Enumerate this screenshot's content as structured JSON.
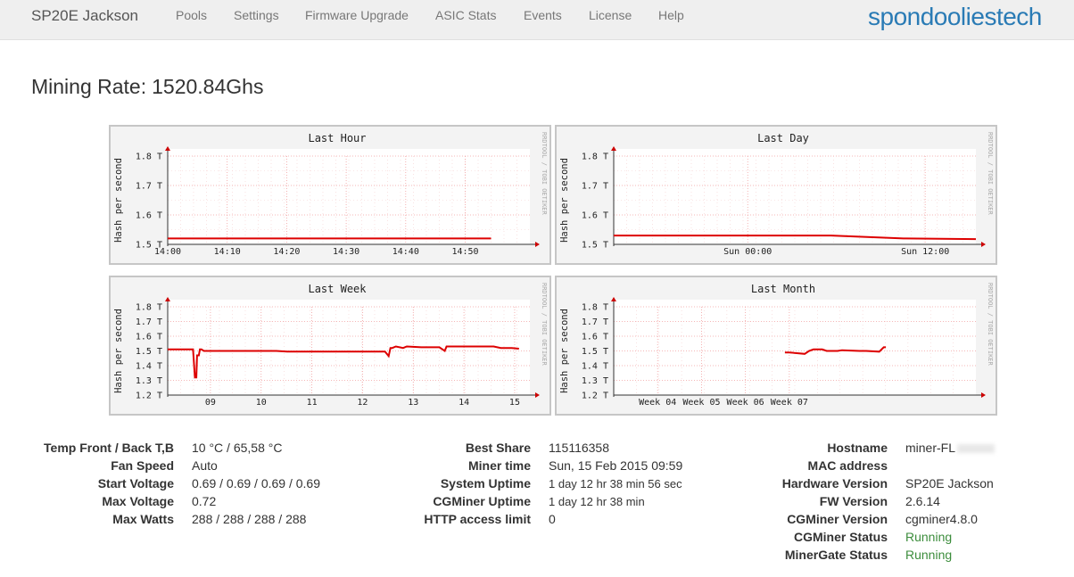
{
  "nav": {
    "brand": "SP20E Jackson",
    "items": [
      "Pools",
      "Settings",
      "Firmware Upgrade",
      "ASIC Stats",
      "Events",
      "License",
      "Help"
    ],
    "logo": "spondooliestech"
  },
  "mining_rate": {
    "label": "Mining Rate:",
    "value": "1520.84Ghs"
  },
  "colors": {
    "line": "#dd0000",
    "accent": "#2a7bb5",
    "running": "#3c8d3c"
  },
  "chart_data": [
    {
      "type": "line",
      "title": "Last Hour",
      "ylabel": "Hash per second",
      "ylim": [
        1.5,
        1.8
      ],
      "yticks": [
        "1.8 T",
        "1.7 T",
        "1.6 T",
        "1.5 T"
      ],
      "xticks": [
        "14:00",
        "14:10",
        "14:20",
        "14:30",
        "14:40",
        "14:50"
      ],
      "watermark": "RRDTOOL / TOBI OETIKER",
      "series": [
        {
          "x": [
            0,
            62.5
          ],
          "y": [
            1.52,
            1.52
          ]
        }
      ]
    },
    {
      "type": "line",
      "title": "Last Day",
      "ylabel": "Hash per second",
      "ylim": [
        1.5,
        1.8
      ],
      "yticks": [
        "1.8 T",
        "1.7 T",
        "1.6 T",
        "1.5 T"
      ],
      "xticks": [
        "Sun 00:00",
        "Sun 12:00"
      ],
      "watermark": "RRDTOOL / TOBI OETIKER",
      "series": [
        {
          "x": [
            0,
            60,
            70,
            80,
            100
          ],
          "y": [
            1.53,
            1.53,
            1.525,
            1.52,
            1.518
          ]
        }
      ]
    },
    {
      "type": "line",
      "title": "Last Week",
      "ylabel": "Hash per second",
      "ylim": [
        1.2,
        1.8
      ],
      "yticks": [
        "1.8 T",
        "1.7 T",
        "1.6 T",
        "1.5 T",
        "1.4 T",
        "1.3 T",
        "1.2 T"
      ],
      "xticks": [
        "09",
        "10",
        "11",
        "12",
        "13",
        "14",
        "15"
      ],
      "watermark": "RRDTOOL / TOBI OETIKER",
      "series": [
        {
          "x": [
            0,
            7,
            7.5,
            7.9,
            8.1,
            8.6,
            8.9,
            9.3,
            10,
            20,
            30,
            33,
            40,
            52,
            60,
            61,
            61.5,
            62,
            63,
            65,
            66,
            70,
            75,
            76.5,
            77,
            78,
            80,
            90,
            92,
            95,
            97
          ],
          "y": [
            1.51,
            1.51,
            1.32,
            1.32,
            1.47,
            1.47,
            1.51,
            1.51,
            1.5,
            1.5,
            1.5,
            1.495,
            1.495,
            1.495,
            1.495,
            1.465,
            1.52,
            1.52,
            1.53,
            1.52,
            1.53,
            1.525,
            1.525,
            1.5,
            1.53,
            1.53,
            1.53,
            1.53,
            1.52,
            1.52,
            1.515
          ]
        }
      ]
    },
    {
      "type": "line",
      "title": "Last Month",
      "ylabel": "Hash per second",
      "ylim": [
        1.2,
        1.8
      ],
      "yticks": [
        "1.8 T",
        "1.7 T",
        "1.6 T",
        "1.5 T",
        "1.4 T",
        "1.3 T",
        "1.2 T"
      ],
      "xticks": [
        "Week 04",
        "Week 05",
        "Week 06",
        "Week 07"
      ],
      "watermark": "RRDTOOL / TOBI OETIKER",
      "series": [
        {
          "x": [
            3.9,
            4.0,
            4.35,
            4.45,
            4.55,
            4.75,
            4.85,
            5.1,
            5.2,
            5.6,
            5.75,
            6.05,
            6.15,
            6.2
          ],
          "y": [
            1.49,
            1.49,
            1.48,
            1.5,
            1.51,
            1.51,
            1.5,
            1.5,
            1.505,
            1.5,
            1.5,
            1.495,
            1.525,
            1.525
          ]
        }
      ]
    }
  ],
  "stats_left": [
    {
      "label": "Temp Front / Back T,B",
      "value": "10 °C / 65,58 °C"
    },
    {
      "label": "Fan Speed",
      "value": "Auto"
    },
    {
      "label": "Start Voltage",
      "value": "0.69 / 0.69 / 0.69 / 0.69"
    },
    {
      "label": "Max Voltage",
      "value": "0.72"
    },
    {
      "label": "Max Watts",
      "value": "288 / 288 / 288 / 288"
    }
  ],
  "stats_mid": [
    {
      "label": "Best Share",
      "value": "115116358"
    },
    {
      "label": "Miner time",
      "value": "Sun, 15 Feb 2015 09:59"
    },
    {
      "label": "System Uptime",
      "value": "1 day 12 hr 38 min 56 sec"
    },
    {
      "label": "CGMiner Uptime",
      "value": "1 day 12 hr 38 min"
    },
    {
      "label": "HTTP access limit",
      "value": "0"
    }
  ],
  "stats_right": [
    {
      "label": "Hostname",
      "value": "miner-FL"
    },
    {
      "label": "MAC address",
      "value": ""
    },
    {
      "label": "Hardware Version",
      "value": "SP20E Jackson"
    },
    {
      "label": "FW Version",
      "value": "2.6.14"
    },
    {
      "label": "CGMiner Version",
      "value": "cgminer4.8.0"
    },
    {
      "label": "CGMiner Status",
      "value": "Running"
    },
    {
      "label": "MinerGate Status",
      "value": "Running"
    }
  ]
}
